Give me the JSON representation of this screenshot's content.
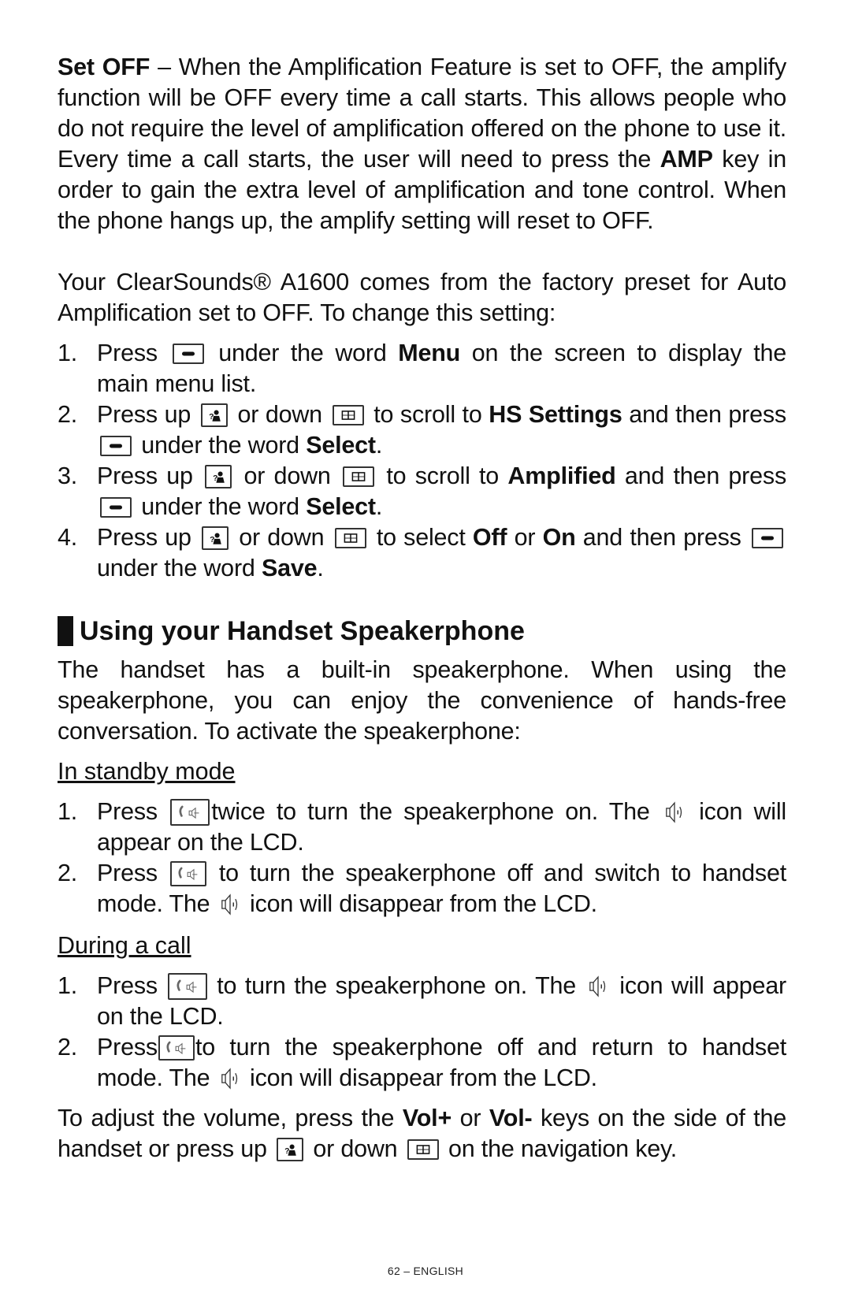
{
  "set_off": {
    "label": "Set OFF",
    "text1": " – When the Amplification Feature is set to OFF, the amplify function will be OFF every time a call starts. This allows people who do not require the level of amplification offered on the phone to use it.  Every time a call starts, the user will need to press the ",
    "amp": "AMP",
    "text2": " key in order to gain the extra level of amplification and tone control.  When the phone hangs up, the amplify setting will reset to OFF."
  },
  "preset": {
    "text": "Your ClearSounds® A1600 comes from the factory preset for Auto Amplification set to OFF.  To change this setting:"
  },
  "steps": [
    {
      "num": "1.",
      "a": "Press ",
      "b": " under the word ",
      "bold1": "Menu",
      "c": " on the screen to display the main menu list."
    },
    {
      "num": "2.",
      "a": "Press up ",
      "b": " or down ",
      "c": " to scroll to ",
      "bold1": "HS Settings",
      "d": " and then press ",
      "e": " under the word ",
      "bold2": "Select",
      "f": "."
    },
    {
      "num": "3.",
      "a": "Press up ",
      "b": " or down ",
      "c": " to scroll to ",
      "bold1": "Amplified",
      "d": " and then press ",
      "e": " under the word ",
      "bold2": "Select",
      "f": "."
    },
    {
      "num": "4.",
      "a": "Press up ",
      "b": " or down ",
      "c": " to select ",
      "bold1": "Off",
      "or": " or ",
      "bold3": "On",
      "d": " and then press ",
      "e": " under the word ",
      "bold2": "Save",
      "f": "."
    }
  ],
  "section": {
    "title": "Using your Handset Speakerphone",
    "intro": "The handset has a built-in speakerphone.  When using the speakerphone, you can enjoy the convenience of hands-free conversation.  To activate the speakerphone:"
  },
  "standby": {
    "title": "In standby mode",
    "steps": [
      {
        "num": "1.",
        "a": "Press ",
        "b": "twice to turn the speakerphone on. The ",
        "c": " icon will appear on the LCD."
      },
      {
        "num": "2.",
        "a": "Press ",
        "b": " to turn the speakerphone off and switch to handset mode.  The ",
        "c": " icon will disappear from the LCD."
      }
    ]
  },
  "during_call": {
    "title": "During a call",
    "steps": [
      {
        "num": "1.",
        "a": "Press ",
        "b": " to turn the speakerphone on.  The ",
        "c": " icon will appear on the LCD."
      },
      {
        "num": "2.",
        "a": "Press",
        "b": "to turn the speakerphone off and return to handset mode.  The ",
        "c": " icon will disappear from the LCD."
      }
    ]
  },
  "volume": {
    "a": "To adjust the volume, press the ",
    "vol_plus": "Vol+",
    "or": " or ",
    "vol_minus": "Vol-",
    "b": " keys on the side of the handset or press up ",
    "c": " or down ",
    "d": " on the navigation key."
  },
  "icons": {
    "soft_key": "soft-key-minus-icon",
    "up_key": "up-key-caller-id-icon",
    "down_key": "down-key-phonebook-icon",
    "speaker_key": "speakerphone-key-icon",
    "speaker_lcd": "speaker-lcd-icon"
  },
  "footer": {
    "page": "62 – ENGLISH"
  }
}
